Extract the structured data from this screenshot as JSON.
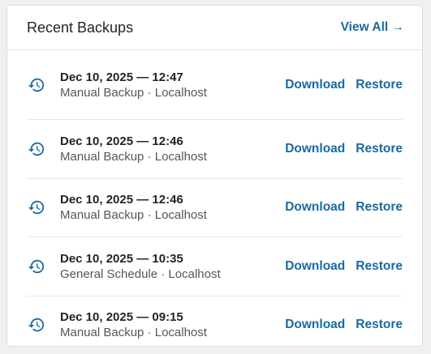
{
  "panel": {
    "title": "Recent Backups",
    "view_all_label": "View All →"
  },
  "backups": [
    {
      "datetime": "Dec 10, 2025 — 12:47",
      "meta": "Manual Backup · Localhost",
      "download_label": "Download",
      "restore_label": "Restore"
    },
    {
      "datetime": "Dec 10, 2025 — 12:46",
      "meta": "Manual Backup · Localhost",
      "download_label": "Download",
      "restore_label": "Restore"
    },
    {
      "datetime": "Dec 10, 2025 — 12:46",
      "meta": "Manual Backup · Localhost",
      "download_label": "Download",
      "restore_label": "Restore"
    },
    {
      "datetime": "Dec 10, 2025 — 10:35",
      "meta": "General Schedule · Localhost",
      "download_label": "Download",
      "restore_label": "Restore"
    },
    {
      "datetime": "Dec 10, 2025 — 09:15",
      "meta": "Manual Backup · Localhost",
      "download_label": "Download",
      "restore_label": "Restore"
    }
  ],
  "icons": {
    "row_icon": "backup-history-icon"
  },
  "colors": {
    "accent": "#1a6b9e",
    "title": "#1d2327",
    "meta": "#50575e"
  }
}
